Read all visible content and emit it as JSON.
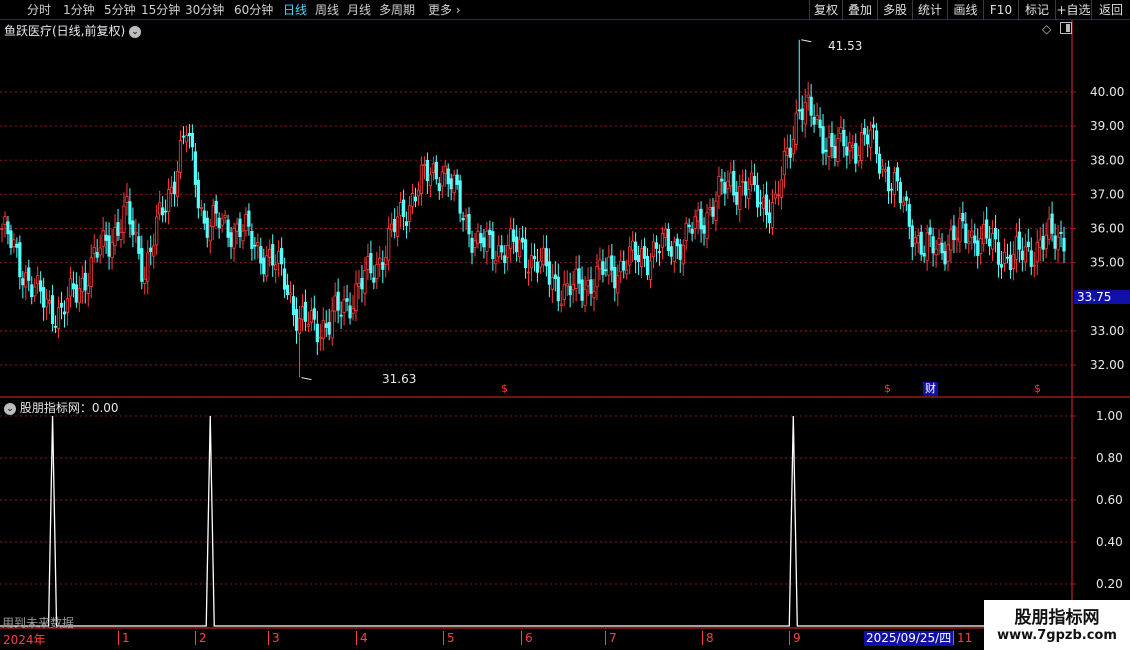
{
  "toolbar": {
    "left_items": [
      "分时",
      "1分钟",
      "5分钟",
      "15分钟",
      "30分钟",
      "60分钟",
      "日线",
      "周线",
      "月线",
      "多周期",
      "更多"
    ],
    "active": "日线",
    "right_items": [
      "复权",
      "叠加",
      "多股",
      "统计",
      "画线",
      "F10",
      "标记",
      "+自选",
      "返回"
    ]
  },
  "stock": {
    "title": "鱼跃医疗(日线,前复权)",
    "high_label": "41.53",
    "low_label": "31.63",
    "current_price": "33.75"
  },
  "main_axis": {
    "ticks": [
      "40.00",
      "39.00",
      "38.00",
      "37.00",
      "36.00",
      "35.00",
      "33.00",
      "32.00"
    ]
  },
  "indicator": {
    "title": "股朋指标网：0.00",
    "ticks": [
      "1.00",
      "0.80",
      "0.60",
      "0.40",
      "0.20"
    ],
    "footer_text": "用到未来数据"
  },
  "markers": {
    "dividend": "$",
    "finance": "财"
  },
  "date_axis": {
    "year_label": "2024年",
    "months": [
      "1",
      "2",
      "3",
      "4",
      "5",
      "6",
      "7",
      "8",
      "9",
      "11"
    ],
    "highlight_date": "2025/09/25/四"
  },
  "watermark": {
    "name": "股朋指标网",
    "url": "www.7gpzb.com"
  },
  "colors": {
    "up": "#ff3b3b",
    "down": "#54ffff",
    "grid": "#8b1a1a",
    "axis": "#9b1a1a",
    "highlight_price_bg": "#1010a8"
  },
  "chart_data": {
    "type": "candlestick",
    "y_range": [
      31.63,
      41.53
    ],
    "anchors": [
      [
        0,
        36.0
      ],
      [
        12,
        34.0
      ],
      [
        20,
        33.5
      ],
      [
        35,
        35.6
      ],
      [
        42,
        36.4
      ],
      [
        48,
        34.8
      ],
      [
        58,
        37.6
      ],
      [
        62,
        38.8
      ],
      [
        68,
        36.2
      ],
      [
        80,
        36.0
      ],
      [
        95,
        34.6
      ],
      [
        100,
        33.2
      ],
      [
        110,
        33.2
      ],
      [
        125,
        34.8
      ],
      [
        140,
        37.3
      ],
      [
        148,
        37.8
      ],
      [
        160,
        35.5
      ],
      [
        175,
        35.4
      ],
      [
        190,
        34.1
      ],
      [
        205,
        34.8
      ],
      [
        215,
        35.2
      ],
      [
        230,
        35.7
      ],
      [
        245,
        37.4
      ],
      [
        260,
        36.6
      ],
      [
        268,
        39.7
      ],
      [
        280,
        38.3
      ],
      [
        292,
        38.6
      ],
      [
        300,
        37.2
      ],
      [
        310,
        35.3
      ],
      [
        325,
        35.9
      ],
      [
        340,
        35.1
      ],
      [
        355,
        35.8
      ]
    ],
    "indicator_spikes": [
      17,
      70,
      266
    ],
    "indicator_range": [
      0,
      1
    ]
  }
}
